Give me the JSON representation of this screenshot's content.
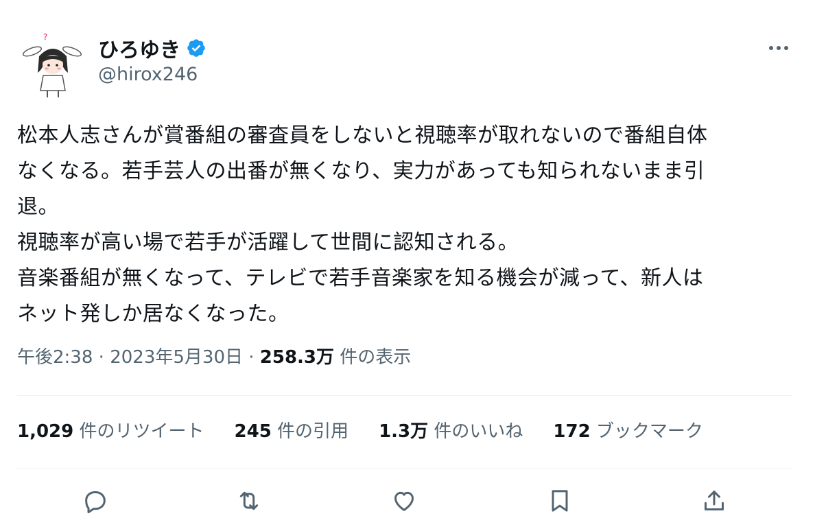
{
  "author": {
    "name": "ひろゆき",
    "handle": "@hirox246",
    "avatar_icon": "character-avatar-icon",
    "verified_icon": "verified-badge-icon"
  },
  "tweet": {
    "text": "松本人志さんが賞番組の審査員をしないと視聴率が取れないので番組自体\nなくなる。若手芸人の出番が無くなり、実力があっても知られないまま引\n退。\n視聴率が高い場で若手が活躍して世間に認知される。\n音楽番組が無くなって、テレビで若手音楽家を知る機会が減って、新人は\nネット発しか居なくなった。"
  },
  "meta": {
    "time": "午後2:38",
    "separator1": " · ",
    "date": "2023年5月30日",
    "separator2": " · ",
    "views_count": "258.3万",
    "views_label": " 件の表示"
  },
  "stats": {
    "retweets": {
      "count": "1,029",
      "label": " 件のリツイート"
    },
    "quotes": {
      "count": "245",
      "label": " 件の引用"
    },
    "likes": {
      "count": "1.3万",
      "label": " 件のいいね"
    },
    "bookmarks": {
      "count": "172",
      "label": " ブックマーク"
    }
  },
  "actions": [
    "reply-icon",
    "retweet-icon",
    "like-icon",
    "bookmark-icon",
    "share-icon"
  ],
  "colors": {
    "text": "#0f1419",
    "secondary": "#536471",
    "verified": "#1d9bf0",
    "divider": "#eff3f4"
  }
}
